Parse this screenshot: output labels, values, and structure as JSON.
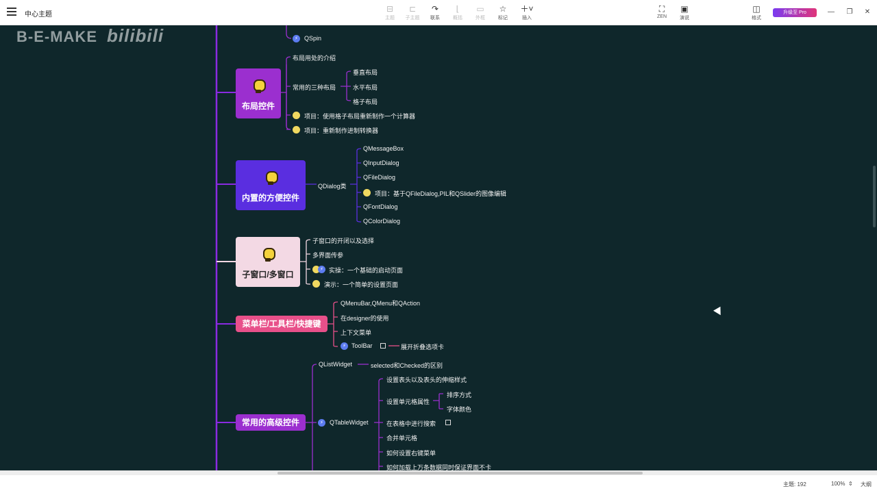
{
  "app": {
    "doc_title": "中心主题"
  },
  "toolbar": {
    "items": [
      {
        "label": "主题",
        "icon": "topic-icon",
        "enabled": false
      },
      {
        "label": "子主题",
        "icon": "subtopic-icon",
        "enabled": false
      },
      {
        "label": "联系",
        "icon": "relationship-icon",
        "enabled": true
      },
      {
        "label": "概括",
        "icon": "summary-icon",
        "enabled": false
      },
      {
        "label": "外框",
        "icon": "boundary-icon",
        "enabled": false
      },
      {
        "label": "标记",
        "icon": "star-icon",
        "enabled": true
      },
      {
        "label": "插入",
        "icon": "plus-icon",
        "enabled": true
      }
    ],
    "zen_label": "ZEN",
    "present_label": "演说",
    "format_label": "格式",
    "pro_label": "升级至 Pro"
  },
  "watermark": {
    "brand": "B-E-MAKE",
    "site": "bilibili"
  },
  "mindmap": {
    "top_partial": {
      "qspin": "QSpin"
    },
    "layout_card": {
      "title": "布局控件",
      "children": [
        "布局用处的介绍",
        "常用的三种布局",
        "项目：使用格子布局重新制作一个计算器",
        "项目：重新制作进制转换器"
      ],
      "layout_types": [
        "垂直布局",
        "水平布局",
        "格子布局"
      ]
    },
    "dialog_card": {
      "title": "内置的方便控件",
      "branch": "QDialog类",
      "children": [
        "QMessageBox",
        "QInputDialog",
        "QFileDialog",
        "项目：基于QFileDialog,PIL和QSlider的图像编辑",
        "QFontDialog",
        "QColorDialog"
      ]
    },
    "window_card": {
      "title": "子窗口/多窗口",
      "children": [
        "子窗口的开闭以及选择",
        "多界面传参",
        "实操：一个基础的启动页面",
        "演示：一个简单的设置页面"
      ]
    },
    "menu_card": {
      "title": "菜单栏/工具栏/快捷键",
      "children": [
        "QMenuBar,QMenu和QAction",
        "在designer的使用",
        "上下文菜单",
        "ToolBar"
      ],
      "toolbar_note": "展开折叠选项卡"
    },
    "advanced_card": {
      "title": "常用的高级控件",
      "list_widget": "QListWidget",
      "list_widget_note": "selected和Checked的区别",
      "table_widget": "QTableWidget",
      "table_children": [
        "设置表头以及表头的伸缩样式",
        "设置单元格属性",
        "在表格中进行搜索",
        "合并单元格",
        "如何设置右键菜单",
        "如何加载上万条数据同时保证界面不卡"
      ],
      "cell_props": [
        "排序方式",
        "字体颜色"
      ]
    },
    "colors": {
      "layout": "#9b2fcf",
      "dialog": "#5a2ee0",
      "window": "#f3d9e4",
      "menu": "#e8508a",
      "advanced": "#9b2fcf",
      "trunk": "#8a2be2",
      "background": "#0f272b"
    }
  },
  "status": {
    "topics": "主题: 192",
    "zoom": "100%",
    "outline": "大纲"
  }
}
